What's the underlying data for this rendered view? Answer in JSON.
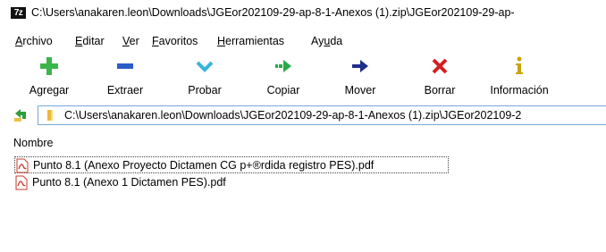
{
  "window": {
    "app_icon_label": "7z",
    "title": "C:\\Users\\anakaren.leon\\Downloads\\JGEor202109-29-ap-8-1-Anexos (1).zip\\JGEor202109-29-ap-"
  },
  "menu": {
    "items": [
      {
        "label": "Archivo",
        "accel": "A"
      },
      {
        "label": "Editar",
        "accel": "E"
      },
      {
        "label": "Ver",
        "accel": "V"
      },
      {
        "label": "Favoritos",
        "accel": "F"
      },
      {
        "label": "Herramientas",
        "accel": "H"
      },
      {
        "label": "Ayuda",
        "accel": "u"
      }
    ]
  },
  "toolbar": {
    "buttons": [
      {
        "label": "Agregar",
        "icon": "plus-icon",
        "color": "#3bb54a"
      },
      {
        "label": "Extraer",
        "icon": "minus-icon",
        "color": "#2b5cc8"
      },
      {
        "label": "Probar",
        "icon": "chevron-down-icon",
        "color": "#36b4d9"
      },
      {
        "label": "Copiar",
        "icon": "copy-arrow-icon",
        "color": "#2aa84a"
      },
      {
        "label": "Mover",
        "icon": "arrow-right-icon",
        "color": "#1e2f8c"
      },
      {
        "label": "Borrar",
        "icon": "x-icon",
        "color": "#d22020"
      },
      {
        "label": "Información",
        "icon": "info-icon",
        "color": "#c9a400"
      }
    ]
  },
  "address": {
    "path": "C:\\Users\\anakaren.leon\\Downloads\\JGEor202109-29-ap-8-1-Anexos (1).zip\\JGEor202109-2"
  },
  "list": {
    "column_name": "Nombre",
    "files": [
      {
        "name": "Punto 8.1 (Anexo Proyecto Dictamen CG p+®rdida registro PES).pdf",
        "icon": "pdf-file-icon",
        "selected": true
      },
      {
        "name": "Punto 8.1 (Anexo 1 Dictamen PES).pdf",
        "icon": "pdf-file-icon",
        "selected": false
      }
    ]
  }
}
